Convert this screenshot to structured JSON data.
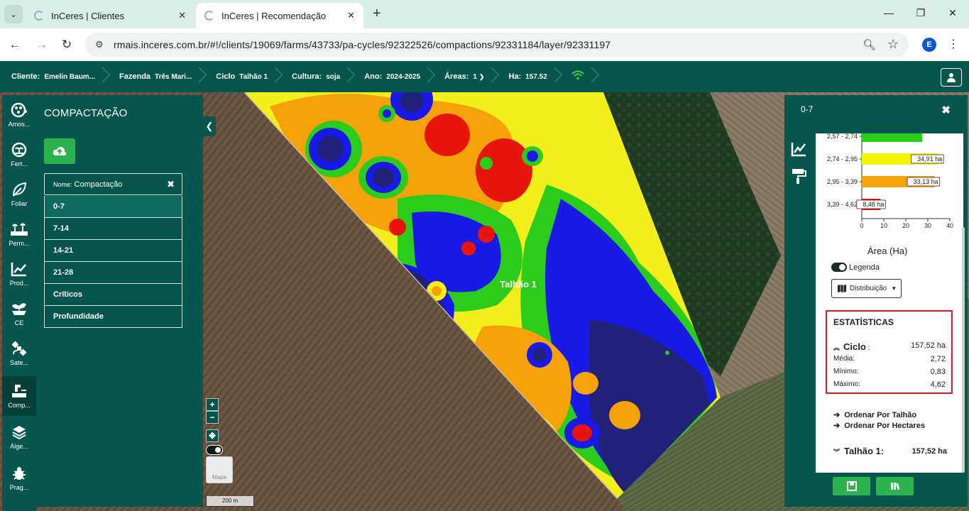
{
  "browser": {
    "tabs": [
      {
        "title": "InCeres | Clientes"
      },
      {
        "title": "InCeres | Recomendação"
      }
    ],
    "url": "rmais.inceres.com.br/#!/clients/19069/farms/43733/pa-cycles/92322526/compactions/92331184/layer/92331197",
    "profile_initial": "E"
  },
  "header": {
    "cliente_label": "Cliente:",
    "cliente_value": "Emelin Baum...",
    "fazenda_label": "Fazenda",
    "fazenda_value": "Três Mari...",
    "ciclo_label": "Ciclo",
    "ciclo_value": "Talhão 1",
    "cultura_label": "Cultura:",
    "cultura_value": "soja",
    "ano_label": "Ano:",
    "ano_value": "2024-2025",
    "areas_label": "Áreas:",
    "areas_value": "1",
    "ha_label": "Ha:",
    "ha_value": "157.52"
  },
  "rail": {
    "items": [
      {
        "label": "Amos...",
        "icon": "sampling-icon"
      },
      {
        "label": "Fert...",
        "icon": "fertility-icon"
      },
      {
        "label": "Foliar",
        "icon": "leaf-icon"
      },
      {
        "label": "Perm...",
        "icon": "permanent-icon"
      },
      {
        "label": "Prod...",
        "icon": "productivity-icon"
      },
      {
        "label": "CE",
        "icon": "sprout-icon"
      },
      {
        "label": "Sate...",
        "icon": "satellite-icon"
      },
      {
        "label": "Comp...",
        "icon": "compaction-icon"
      },
      {
        "label": "Álge...",
        "icon": "layers-icon"
      },
      {
        "label": "Prag...",
        "icon": "bug-icon"
      }
    ]
  },
  "panel": {
    "title": "COMPACTAÇÃO",
    "name_label": "Nome:",
    "name_value": "Compactação",
    "layers": [
      "0-7",
      "7-14",
      "14-21",
      "21-28",
      "Críticos",
      "Profundidade"
    ]
  },
  "map": {
    "field_label": "Talhão 1",
    "maps_thumb_label": "Mapa",
    "scale_label": "200 m",
    "zoom_in": "+",
    "zoom_out": "−"
  },
  "right_panel": {
    "title": "0-7",
    "chart_data": {
      "type": "bar",
      "orientation": "horizontal",
      "categories": [
        "2,57 - 2,74",
        "2,74 - 2,95",
        "2,95 - 3,39",
        "3,39 - 4,62"
      ],
      "values": [
        27.5,
        34.91,
        33.13,
        8.48
      ],
      "value_labels": [
        "",
        "34,91 ha",
        "33,13 ha",
        "8,48 ha"
      ],
      "colors": [
        "#2ccc1c",
        "#f5f50a",
        "#f5a20a",
        "#e8150d"
      ],
      "xlim": [
        0,
        40
      ],
      "xticks": [
        "0",
        "10",
        "20",
        "30",
        "40"
      ],
      "xlabel": "Área (Ha)"
    },
    "legend_label": "Legenda",
    "distribution_label": "Distribuição",
    "stats": {
      "title": "ESTATÍSTICAS",
      "ciclo_label": "Ciclo",
      "ciclo_value": "157,52 ha",
      "media_label": "Média:",
      "media_value": "2,72",
      "minimo_label": "Mínimo:",
      "minimo_value": "0,83",
      "maximo_label": "Máximo:",
      "maximo_value": "4,62"
    },
    "order_by_field": "Ordenar Por Talhão",
    "order_by_hectares": "Ordenar Por Hectares",
    "field_total_label": "Talhão 1:",
    "field_total_value": "157,52 ha"
  }
}
